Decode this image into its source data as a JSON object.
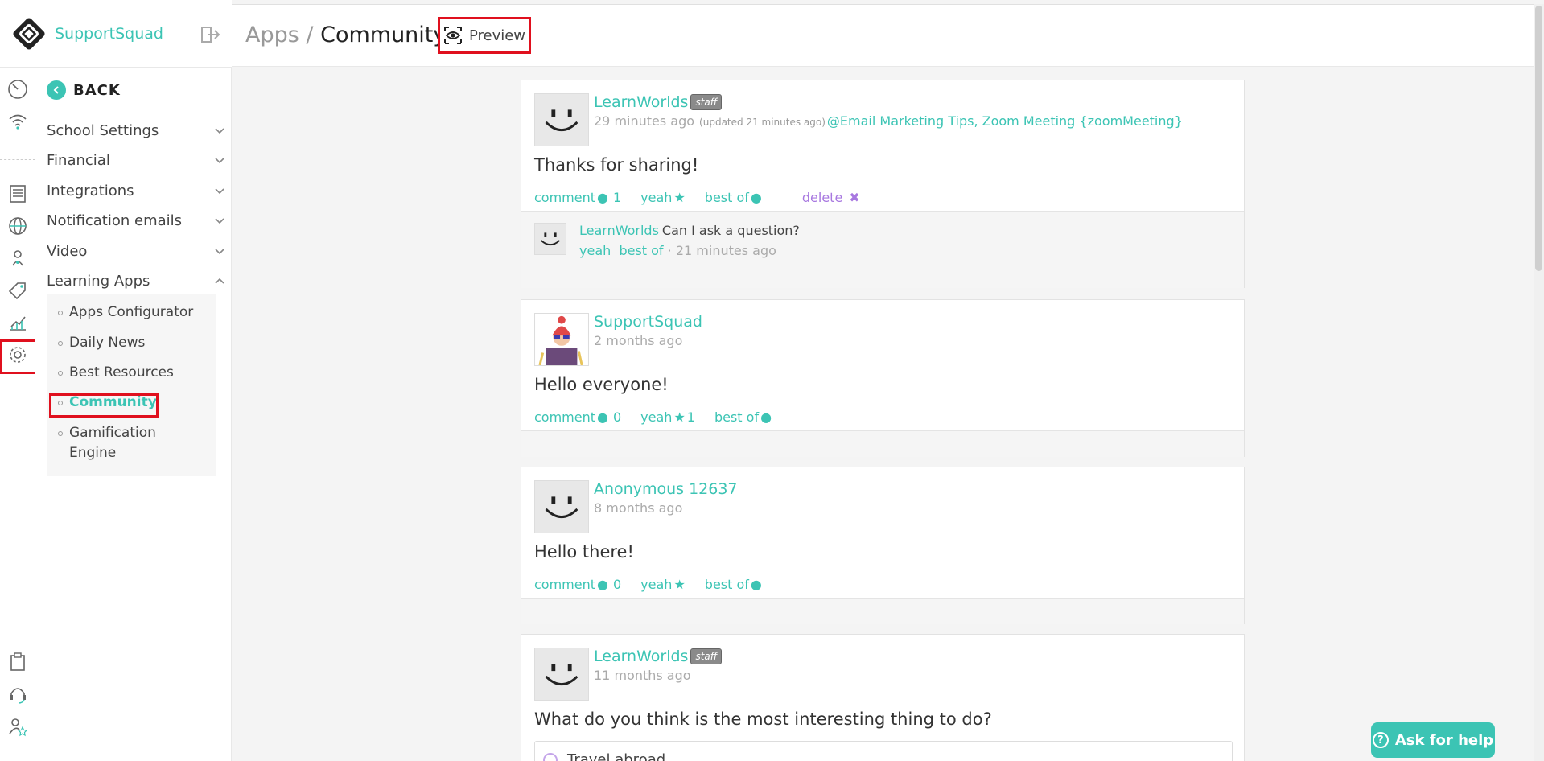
{
  "brand": {
    "name": "SupportSquad"
  },
  "nav": {
    "back_label": "BACK",
    "items": [
      {
        "label": "School Settings"
      },
      {
        "label": "Financial"
      },
      {
        "label": "Integrations"
      },
      {
        "label": "Notification emails"
      },
      {
        "label": "Video"
      },
      {
        "label": "Learning Apps"
      }
    ],
    "sub_items": [
      {
        "label": "Apps Configurator"
      },
      {
        "label": "Daily News"
      },
      {
        "label": "Best Resources"
      },
      {
        "label": "Community"
      },
      {
        "label": "Gamification Engine"
      }
    ],
    "active_sub": "Community"
  },
  "header": {
    "crumb_parent": "Apps /",
    "crumb_current": "Community",
    "preview_label": "Preview"
  },
  "posts": [
    {
      "author": "LearnWorlds",
      "staff": "staff",
      "time": "29 minutes ago",
      "updated": "(updated 21 minutes ago)",
      "tags": "@Email Marketing Tips, Zoom Meeting {zoomMeeting}",
      "body": "Thanks for sharing!",
      "comment_label": "comment",
      "comment_count": "1",
      "yeah_label": "yeah",
      "yeah_count": "",
      "bestof_label": "best of",
      "delete_label": "delete",
      "reply": {
        "author": "LearnWorlds",
        "text": "Can I ask a question?",
        "yeah_label": "yeah",
        "bestof_label": "best of",
        "sep": "·",
        "time": "21 minutes ago"
      }
    },
    {
      "author": "SupportSquad",
      "time": "2 months ago",
      "body": "Hello everyone!",
      "comment_label": "comment",
      "comment_count": "0",
      "yeah_label": "yeah",
      "yeah_count": "1",
      "bestof_label": "best of"
    },
    {
      "author": "Anonymous 12637",
      "time": "8 months ago",
      "body": "Hello there!",
      "comment_label": "comment",
      "comment_count": "0",
      "yeah_label": "yeah",
      "yeah_count": "",
      "bestof_label": "best of"
    },
    {
      "author": "LearnWorlds",
      "staff": "staff",
      "time": "11 months ago",
      "body": "What do you think is the most interesting thing to do?",
      "poll_option": "Travel abroad"
    }
  ],
  "help": {
    "label": "Ask for help",
    "icon_glyph": "?"
  },
  "colors": {
    "accent": "#3cc4b4",
    "highlight": "#e0101e",
    "delete": "#a878e0"
  }
}
